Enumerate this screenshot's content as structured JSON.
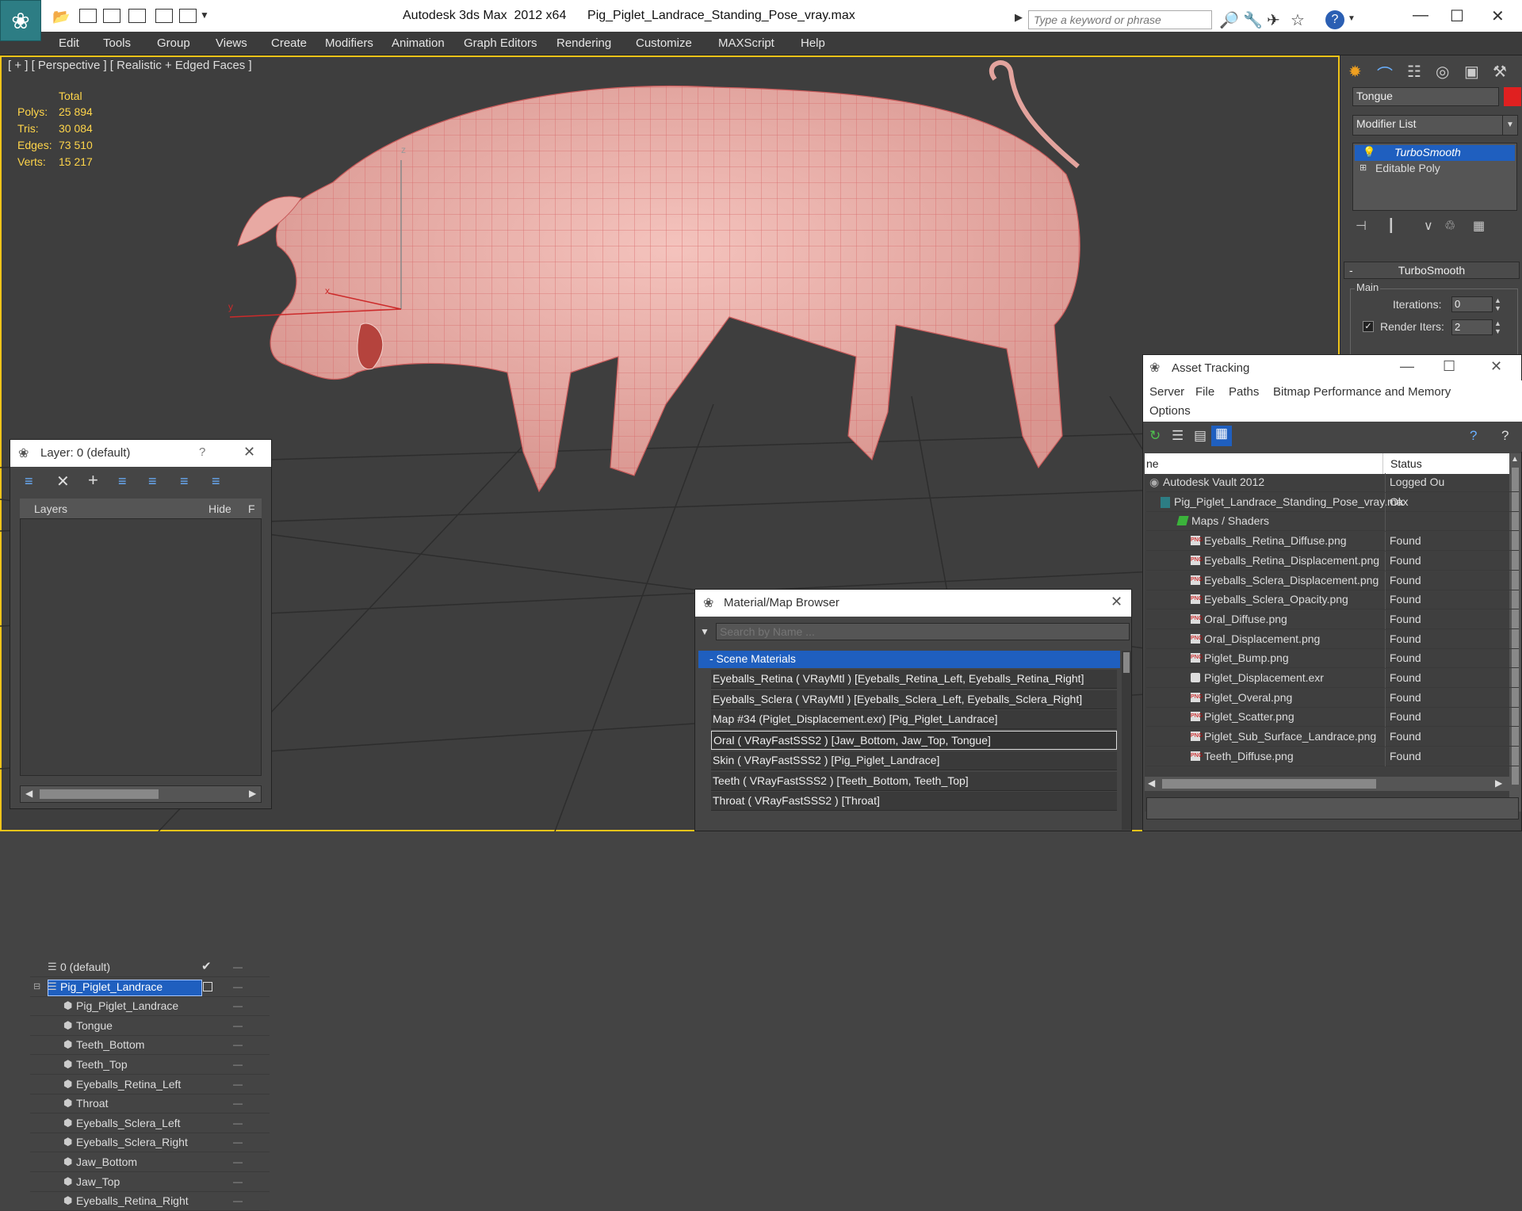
{
  "app": {
    "title": "Autodesk 3ds Max  2012 x64",
    "file": "Pig_Piglet_Landrace_Standing_Pose_vray.max",
    "search_placeholder": "Type a keyword or phrase"
  },
  "menu": [
    "Edit",
    "Tools",
    "Group",
    "Views",
    "Create",
    "Modifiers",
    "Animation",
    "Graph Editors",
    "Rendering",
    "Customize",
    "MAXScript",
    "Help"
  ],
  "viewport": {
    "label": "[ + ] [ Perspective ] [ Realistic + Edged Faces ]",
    "stats": {
      "header": "Total",
      "rows": [
        {
          "label": "Polys:",
          "value": "25 894"
        },
        {
          "label": "Tris:",
          "value": "30 084"
        },
        {
          "label": "Edges:",
          "value": "73 510"
        },
        {
          "label": "Verts:",
          "value": "15 217"
        }
      ]
    },
    "axes": {
      "z": "z",
      "y": "y",
      "x": "x"
    }
  },
  "command_panel": {
    "object_name": "Tongue",
    "modifier_list": "Modifier List",
    "stack": [
      "TurboSmooth",
      "Editable Poly"
    ],
    "rollout_title": "TurboSmooth",
    "group": "Main",
    "iterations_label": "Iterations:",
    "iterations_value": "0",
    "render_iters_label": "Render Iters:",
    "render_iters_value": "2"
  },
  "layer_window": {
    "title": "Layer: 0 (default)",
    "help": "?",
    "columns": [
      "Layers",
      "Hide",
      "F"
    ],
    "rows": [
      {
        "name": "0 (default)",
        "level": 0,
        "kind": "layer"
      },
      {
        "name": "Pig_Piglet_Landrace",
        "level": 0,
        "kind": "layer",
        "selected": true
      },
      {
        "name": "Pig_Piglet_Landrace",
        "level": 1,
        "kind": "object"
      },
      {
        "name": "Tongue",
        "level": 1,
        "kind": "object"
      },
      {
        "name": "Teeth_Bottom",
        "level": 1,
        "kind": "object"
      },
      {
        "name": "Teeth_Top",
        "level": 1,
        "kind": "object"
      },
      {
        "name": "Eyeballs_Retina_Left",
        "level": 1,
        "kind": "object"
      },
      {
        "name": "Throat",
        "level": 1,
        "kind": "object"
      },
      {
        "name": "Eyeballs_Sclera_Left",
        "level": 1,
        "kind": "object"
      },
      {
        "name": "Eyeballs_Sclera_Right",
        "level": 1,
        "kind": "object"
      },
      {
        "name": "Jaw_Bottom",
        "level": 1,
        "kind": "object"
      },
      {
        "name": "Jaw_Top",
        "level": 1,
        "kind": "object"
      },
      {
        "name": "Eyeballs_Retina_Right",
        "level": 1,
        "kind": "object"
      }
    ]
  },
  "material_browser": {
    "title": "Material/Map Browser",
    "search_placeholder": "Search by Name ...",
    "group": "- Scene Materials",
    "items": [
      "Eyeballs_Retina  ( VRayMtl ) [Eyeballs_Retina_Left, Eyeballs_Retina_Right]",
      "Eyeballs_Sclera  ( VRayMtl ) [Eyeballs_Sclera_Left, Eyeballs_Sclera_Right]",
      "Map #34 (Piglet_Displacement.exr) [Pig_Piglet_Landrace]",
      "Oral  ( VRayFastSSS2 ) [Jaw_Bottom, Jaw_Top, Tongue]",
      "Skin  ( VRayFastSSS2 ) [Pig_Piglet_Landrace]",
      "Teeth  ( VRayFastSSS2 ) [Teeth_Bottom, Teeth_Top]",
      "Throat  ( VRayFastSSS2 ) [Throat]"
    ]
  },
  "asset_tracking": {
    "title": "Asset Tracking",
    "menu": [
      "Server",
      "File",
      "Paths",
      "Bitmap Performance and Memory",
      "Options"
    ],
    "columns": [
      "ne",
      "Status"
    ],
    "rows": [
      {
        "name": "Autodesk Vault 2012",
        "status": "Logged Ou",
        "level": 0,
        "icon": "vault"
      },
      {
        "name": "Pig_Piglet_Landrace_Standing_Pose_vray.max",
        "status": "Ok",
        "level": 1,
        "icon": "max"
      },
      {
        "name": "Maps / Shaders",
        "status": "",
        "level": 2,
        "icon": "folder"
      },
      {
        "name": "Eyeballs_Retina_Diffuse.png",
        "status": "Found",
        "level": 3,
        "icon": "png"
      },
      {
        "name": "Eyeballs_Retina_Displacement.png",
        "status": "Found",
        "level": 3,
        "icon": "png"
      },
      {
        "name": "Eyeballs_Sclera_Displacement.png",
        "status": "Found",
        "level": 3,
        "icon": "png"
      },
      {
        "name": "Eyeballs_Sclera_Opacity.png",
        "status": "Found",
        "level": 3,
        "icon": "png"
      },
      {
        "name": "Oral_Diffuse.png",
        "status": "Found",
        "level": 3,
        "icon": "png"
      },
      {
        "name": "Oral_Displacement.png",
        "status": "Found",
        "level": 3,
        "icon": "png"
      },
      {
        "name": "Piglet_Bump.png",
        "status": "Found",
        "level": 3,
        "icon": "png"
      },
      {
        "name": "Piglet_Displacement.exr",
        "status": "Found",
        "level": 3,
        "icon": "exr"
      },
      {
        "name": "Piglet_Overal.png",
        "status": "Found",
        "level": 3,
        "icon": "png"
      },
      {
        "name": "Piglet_Scatter.png",
        "status": "Found",
        "level": 3,
        "icon": "png"
      },
      {
        "name": "Piglet_Sub_Surface_Landrace.png",
        "status": "Found",
        "level": 3,
        "icon": "png"
      },
      {
        "name": "Teeth_Diffuse.png",
        "status": "Found",
        "level": 3,
        "icon": "png"
      }
    ]
  },
  "colors": {
    "selection": "#1f5fbf",
    "stat_text": "#ffd54a",
    "object_color": "#e02020",
    "pig_skin": "#e9aaa4"
  }
}
